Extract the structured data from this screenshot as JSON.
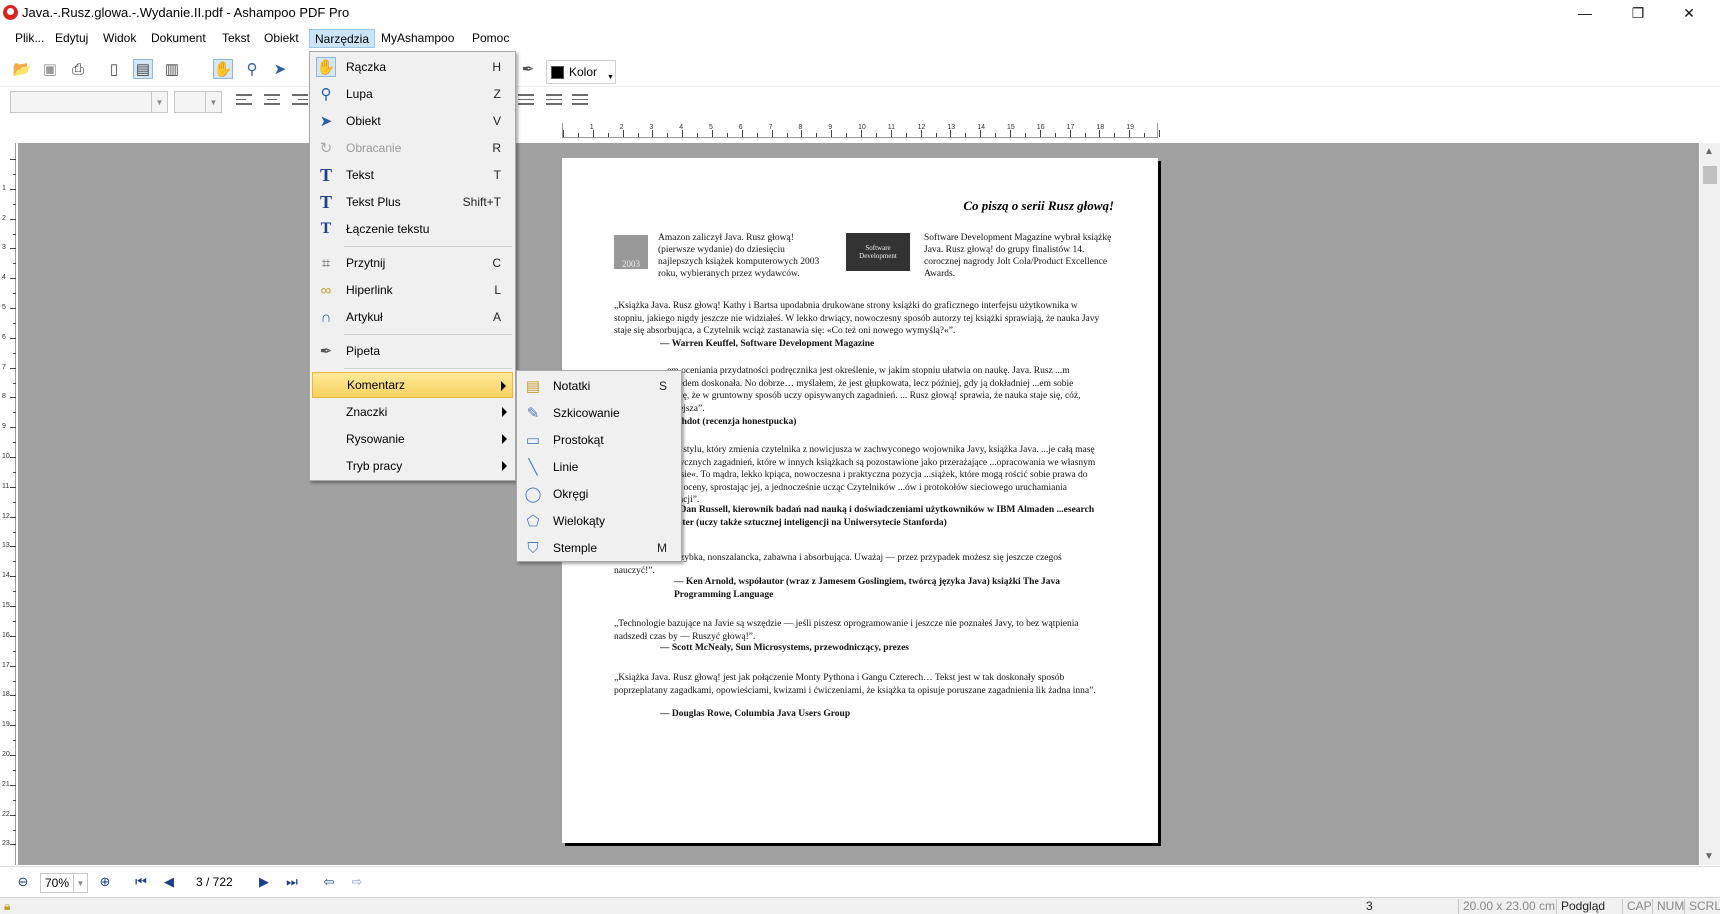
{
  "window": {
    "title": "Java.-.Rusz.glowa.-.Wydanie.II.pdf - Ashampoo PDF Pro",
    "minimize_glyph": "—",
    "restore_glyph": "❐",
    "close_glyph": "✕"
  },
  "menubar": {
    "items": [
      "Plik...",
      "Edytuj",
      "Widok",
      "Dokument",
      "Tekst",
      "Obiekt",
      "Narzędzia",
      "MyAshampoo",
      "Pomoc"
    ],
    "active": "Narzędzia"
  },
  "toolbar": {
    "color_label": "Kolor",
    "icons": [
      "open-folder-icon",
      "save-icon",
      "print-icon",
      "single-page-icon",
      "facing-page-icon",
      "continuous-page-icon",
      "hand-icon",
      "magnifier-icon",
      "pointer-icon",
      "eyedropper-icon",
      "color-swatch-icon"
    ]
  },
  "tools_menu": {
    "items": [
      {
        "label": "Rączka",
        "shortcut": "H",
        "icon": "hand-icon"
      },
      {
        "label": "Lupa",
        "shortcut": "Z",
        "icon": "magnifier-icon"
      },
      {
        "label": "Obiekt",
        "shortcut": "V",
        "icon": "pointer-icon"
      },
      {
        "label": "Obracanie",
        "shortcut": "R",
        "icon": "rotate-icon",
        "disabled": true
      },
      {
        "label": "Tekst",
        "shortcut": "T",
        "icon": "text-tool-icon"
      },
      {
        "label": "Tekst Plus",
        "shortcut": "Shift+T",
        "icon": "text-plus-icon"
      },
      {
        "label": "Łączenie tekstu",
        "shortcut": "",
        "icon": "text-join-icon"
      },
      {
        "label": "Przytnij",
        "shortcut": "C",
        "icon": "crop-icon"
      },
      {
        "label": "Hiperlink",
        "shortcut": "L",
        "icon": "hyperlink-icon"
      },
      {
        "label": "Artykuł",
        "shortcut": "A",
        "icon": "article-icon"
      },
      {
        "label": "Pipeta",
        "shortcut": "",
        "icon": "pipette-icon"
      },
      {
        "label": "Komentarz",
        "shortcut": "",
        "submenu": true
      },
      {
        "label": "Znaczki",
        "shortcut": "",
        "submenu": true
      },
      {
        "label": "Rysowanie",
        "shortcut": "",
        "submenu": true
      },
      {
        "label": "Tryb pracy",
        "shortcut": "",
        "submenu": true
      }
    ]
  },
  "comment_submenu": {
    "items": [
      {
        "label": "Notatki",
        "shortcut": "S",
        "icon": "note-icon"
      },
      {
        "label": "Szkicowanie",
        "shortcut": "",
        "icon": "sketch-icon"
      },
      {
        "label": "Prostokąt",
        "shortcut": "",
        "icon": "rectangle-icon"
      },
      {
        "label": "Linie",
        "shortcut": "",
        "icon": "line-icon"
      },
      {
        "label": "Okręgi",
        "shortcut": "",
        "icon": "circle-icon"
      },
      {
        "label": "Wielokąty",
        "shortcut": "",
        "icon": "polygon-icon"
      },
      {
        "label": "Stemple",
        "shortcut": "M",
        "icon": "stamp-icon"
      }
    ]
  },
  "page": {
    "heading": "Co piszą o serii Rusz głową!",
    "award1": "Amazon zaliczył Java. Rusz głową! (pierwsze wydanie) do dziesięciu najlepszych książek komputerowych 2003 roku, wybieranych przez wydawców.",
    "award1_img": "2003",
    "award2": "Software Development Magazine wybrał książkę Java. Rusz głową! do grupy finalistów 14. corocznej nagrody Jolt Cola/Product Excellence Awards.",
    "award2_img": "Software Development",
    "quotes": [
      {
        "text": "„Książka Java. Rusz głową! Kathy i Bartsa upodabnia drukowane strony książki do graficznego interfejsu użytkownika w stopniu, jakiego nigdy jeszcze nie widziałeś. W lekko drwiący, nowoczesny sposób autorzy tej książki sprawiają, że nauka Javy staje się absorbująca, a Czytelnik wciąż zastanawia się: «Co też oni nowego wymyślą?«”.",
        "author": "— Warren Keuffel, Software Development Magazine"
      },
      {
        "text": "...em oceniania przydatności podręcznika jest określenie, w jakim stopniu ułatwia on naukę. Java. Rusz ...m względem doskonała. No dobrze… myślałem, że jest głupkowata, lecz później, gdy ją dokładniej ...em sobie sprawę, że w gruntowny sposób uczy opisywanych zagadnień. ... Rusz głową! sprawia, że nauka staje się, cóż, łatwiejsza”.",
        "author": "...ashdot (recenzja honestpucka)"
      },
      {
        "text": "...ego stylu, który zmienia czytelnika z nowicjusza w zachwyconego wojownika Javy, książka Java. ...je całą masę praktycznych zagadnień, które w innych książkach są pozostawione jako przerażające ...opracowania we własnym zakresie«. To mądra, lekko kpiąca, nowoczesna i praktyczna pozycja ...siążek, które mogą rościć sobie prawa do takiej oceny, sprostając jej, a jednocześnie ucząc Czytelników ...ów i protokołów sieciowego uruchamiania aplikacji”.",
        "author": "...r Dan Russell, kierownik badań nad nauką i doświadczeniami użytkowników w IBM Almaden ...esearch Center (uczy także sztucznej inteligencji na Uniwersytecie Stanforda)"
      },
      {
        "text": "„Ta książka jest szybka, nonszalancka, zabawna i absorbująca. Uważaj — przez przypadek możesz się jeszcze czegoś nauczyć!”.",
        "author": "— Ken Arnold, współautor (wraz z Jamesem Goslingiem, twórcą języka Java) książki The Java Programming Language"
      },
      {
        "text": "„Technologie bazujące na Javie są wszędzie — jeśli piszesz oprogramowanie i jeszcze nie poznałeś Javy, to bez wątpienia nadszedł czas by — Ruszyć głową!”.",
        "author": "— Scott McNealy, Sun Microsystems, przewodniczący, prezes"
      },
      {
        "text": "„Książka Java. Rusz głową! jest jak połączenie Monty Pythona i Gangu Czterech… Tekst jest w tak doskonały sposób poprzeplatany zagadkami, opowieściami, kwizami i ćwiczeniami, że książka ta opisuje poruszane zagadnienia lik żadna inna”.",
        "author": "— Douglas Rowe, Columbia Java Users Group"
      }
    ]
  },
  "navbar": {
    "zoom": "70%",
    "page_indicator": "3 / 722"
  },
  "statusbar": {
    "page": "3",
    "size": "20.00 x 23.00 cm",
    "mode": "Podgląd",
    "cap": "CAP",
    "num": "NUM",
    "scrl": "SCRL"
  }
}
